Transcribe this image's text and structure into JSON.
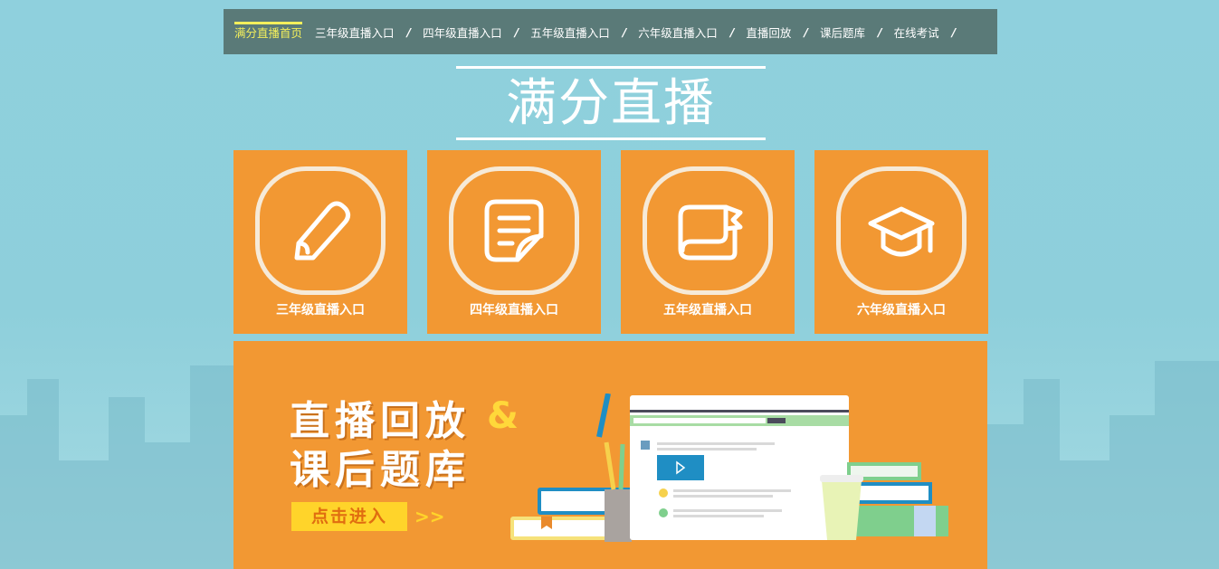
{
  "nav": {
    "items": [
      {
        "label": "满分直播首页",
        "active": true
      },
      {
        "label": "三年级直播入口"
      },
      {
        "label": "四年级直播入口"
      },
      {
        "label": "五年级直播入口"
      },
      {
        "label": "六年级直播入口"
      },
      {
        "label": "直播回放"
      },
      {
        "label": "课后题库"
      },
      {
        "label": "在线考试"
      }
    ],
    "separator": "/"
  },
  "page_title": "满分直播",
  "cards": [
    {
      "label": "三年级直播入口",
      "icon": "pencil-icon"
    },
    {
      "label": "四年级直播入口",
      "icon": "document-icon"
    },
    {
      "label": "五年级直播入口",
      "icon": "book-bookmark-icon"
    },
    {
      "label": "六年级直播入口",
      "icon": "graduation-cap-icon"
    }
  ],
  "banner": {
    "line1": "直播回放",
    "amp": "&",
    "line2": "课后题库",
    "button": "点击进入",
    "arrows": ">>"
  },
  "colors": {
    "background": "#8fd0dd",
    "nav": "#5a7a78",
    "active": "#f3ef5c",
    "card": "#f29833",
    "button": "#ffd42a"
  }
}
